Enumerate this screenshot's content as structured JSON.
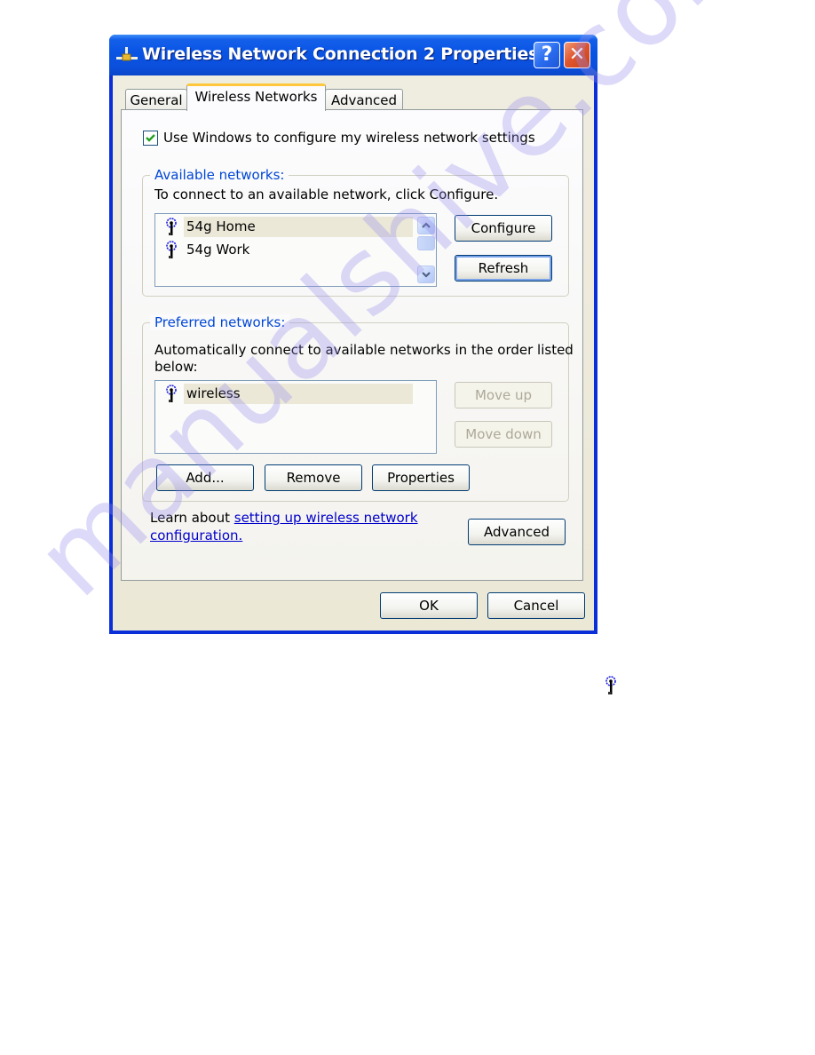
{
  "window": {
    "title": "Wireless Network Connection 2 Properties",
    "help_label": "?",
    "close_label": "✕"
  },
  "tabs": [
    {
      "label": "General",
      "active": false
    },
    {
      "label": "Wireless Networks",
      "active": true
    },
    {
      "label": "Advanced",
      "active": false
    }
  ],
  "use_windows_checkbox": {
    "label": "Use Windows to configure my wireless network settings",
    "checked": true
  },
  "available_networks": {
    "legend": "Available networks:",
    "instruction": "To connect to an available network, click Configure.",
    "items": [
      {
        "name": "54g Home",
        "selected": true
      },
      {
        "name": "54g Work",
        "selected": false
      }
    ],
    "configure_label": "Configure",
    "refresh_label": "Refresh"
  },
  "preferred_networks": {
    "legend": "Preferred networks:",
    "instruction_line1": "Automatically connect to available networks in the order listed",
    "instruction_line2": "below:",
    "items": [
      {
        "name": "wireless",
        "selected": true
      }
    ],
    "move_up_label": "Move up",
    "move_down_label": "Move down",
    "add_label": "Add...",
    "remove_label": "Remove",
    "properties_label": "Properties"
  },
  "learn": {
    "prefix": "Learn about ",
    "link_line1": "setting up wireless network",
    "link_line2": "configuration."
  },
  "advanced_label": "Advanced",
  "ok_label": "OK",
  "cancel_label": "Cancel",
  "watermark": "manualshive.com",
  "colors": {
    "titlebar": "#0a55e4",
    "legend_text": "#0046d5",
    "tab_highlight": "#ffc83c",
    "link": "#0000cc"
  }
}
